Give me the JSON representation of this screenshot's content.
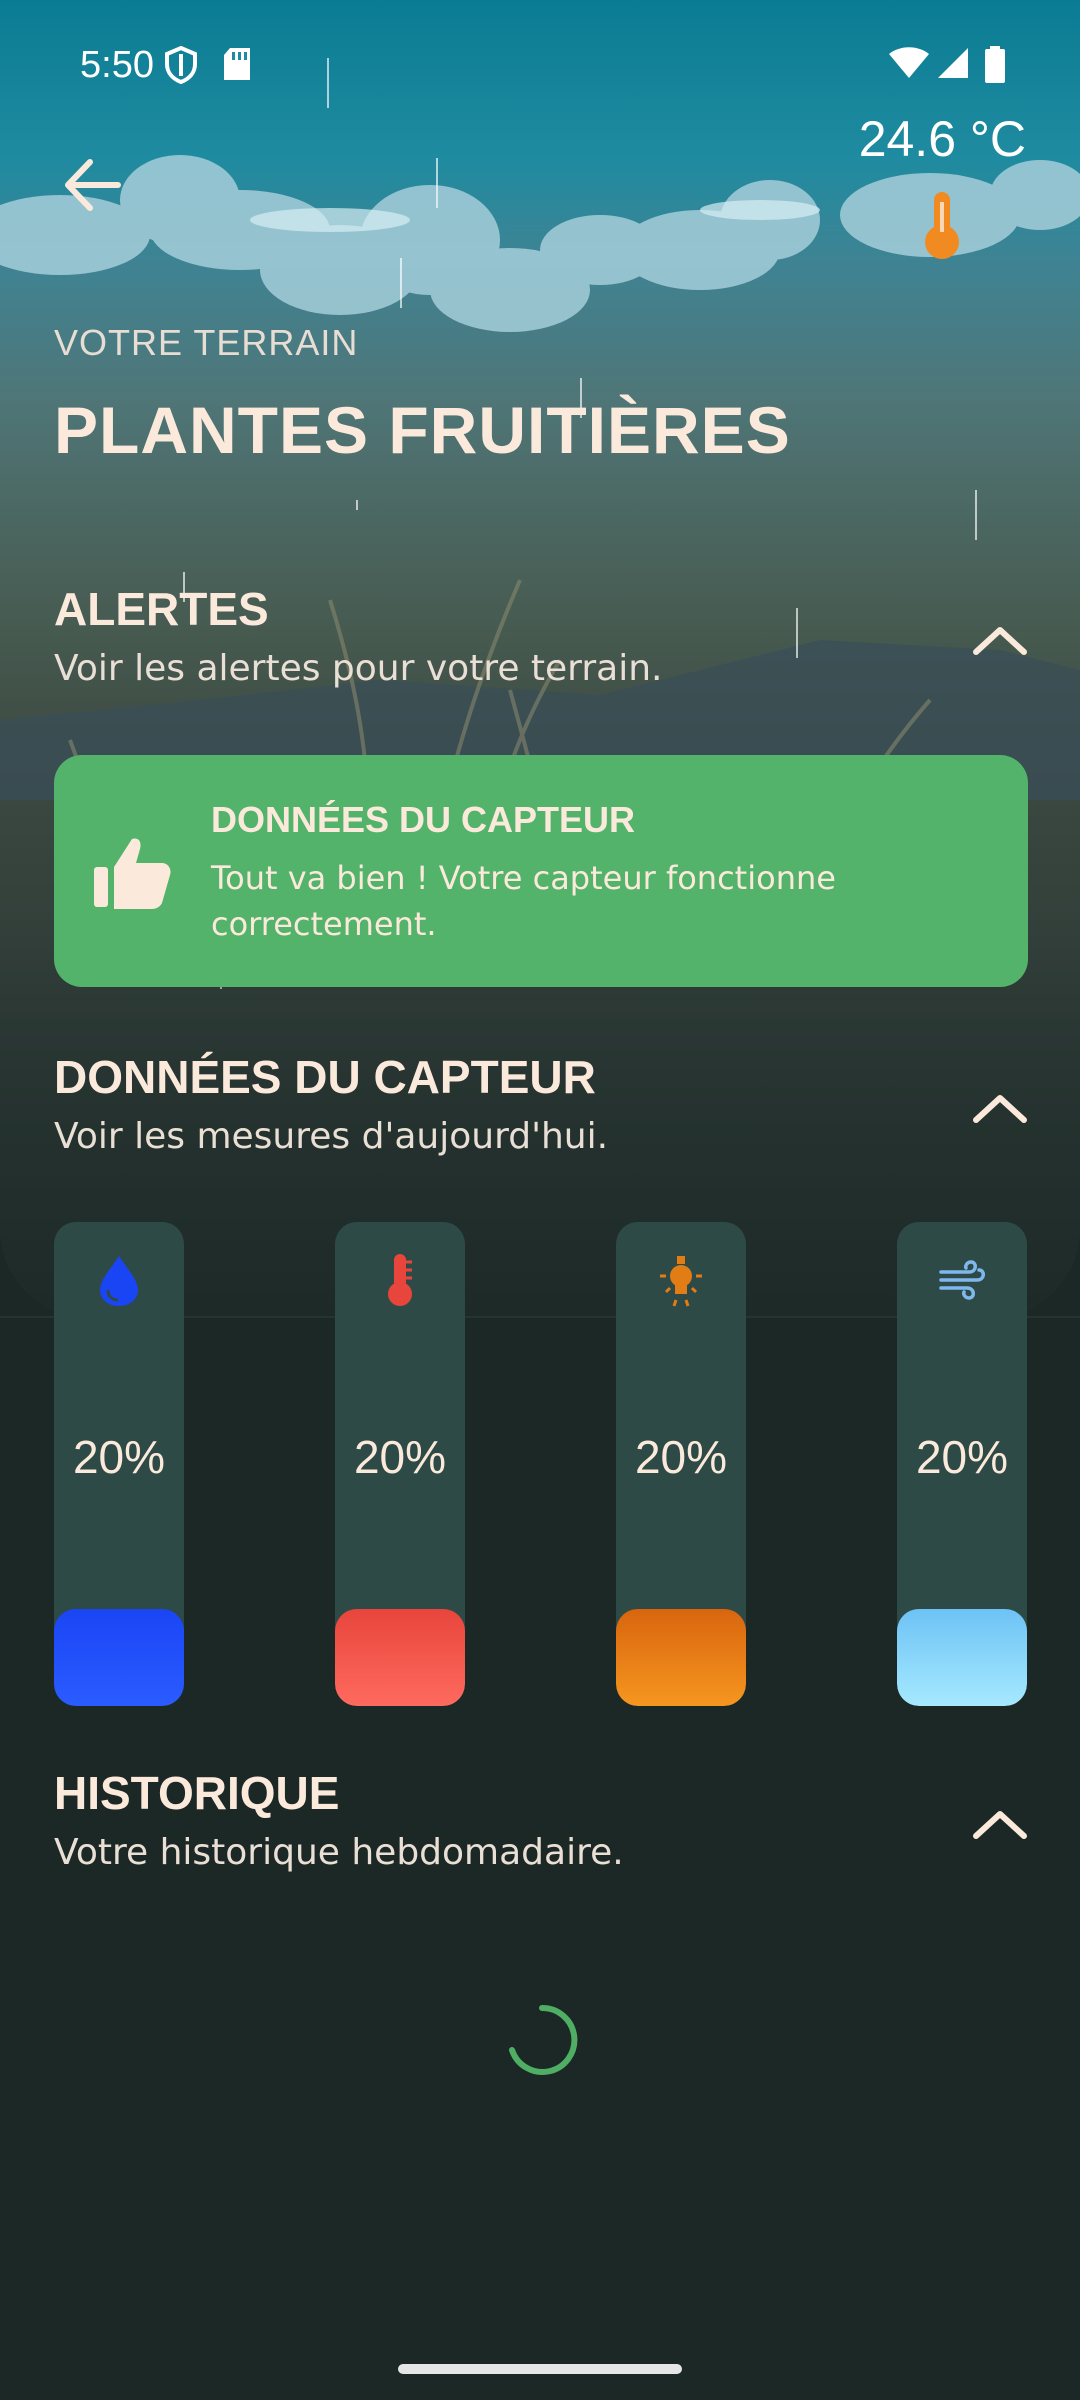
{
  "status_bar": {
    "time": "5:50"
  },
  "header": {
    "temperature": "24.6 °C",
    "eyebrow": "VOTRE TERRAIN",
    "title": "PLANTES FRUITIÈRES"
  },
  "alerts": {
    "title": "ALERTES",
    "subtitle": "Voir les alertes pour votre terrain.",
    "card": {
      "title": "DONNÉES DU CAPTEUR",
      "message": "Tout va bien ! Votre capteur fonctionne correctement.",
      "color": "#54b36b"
    }
  },
  "sensor_section": {
    "title": "DONNÉES DU CAPTEUR",
    "subtitle": "Voir les mesures d'aujourd'hui.",
    "sensors": [
      {
        "name": "humidity",
        "icon": "water-drop-icon",
        "value": "20%",
        "level": 0.2,
        "color": "#1a45f5"
      },
      {
        "name": "temperature",
        "icon": "thermometer-icon",
        "value": "20%",
        "level": 0.2,
        "color": "#e8453c"
      },
      {
        "name": "light",
        "icon": "light-bulb-icon",
        "value": "20%",
        "level": 0.2,
        "color": "#e27c14"
      },
      {
        "name": "wind",
        "icon": "wind-icon",
        "value": "20%",
        "level": 0.2,
        "color": "#7fd2f2"
      }
    ]
  },
  "history": {
    "title": "HISTORIQUE",
    "subtitle": "Votre historique hebdomadaire."
  }
}
